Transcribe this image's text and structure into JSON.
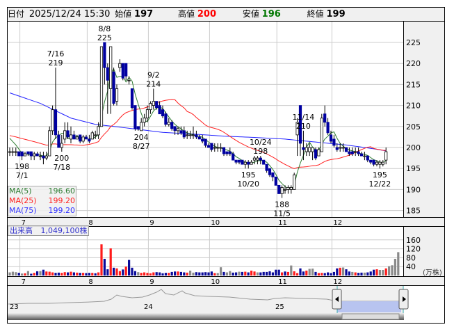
{
  "header": {
    "date_label": "日付",
    "datetime": "2025/12/24 15:30",
    "open_label": "始値",
    "open": "197",
    "high_label": "高値",
    "high": "200",
    "low_label": "安値",
    "low": "196",
    "close_label": "終値",
    "close": "199"
  },
  "legend": {
    "ma5_label": "MA(5)",
    "ma5": "196.60",
    "ma25_label": "MA(25)",
    "ma25": "199.20",
    "ma75_label": "MA(75)",
    "ma75": "199.20"
  },
  "volume": {
    "label": "出来高",
    "value": "1,049,100株",
    "unit": "(万株)"
  },
  "colors": {
    "up_candle": "#ffffff",
    "down_candle": "#0000a0",
    "ma5": "#2e7d32",
    "ma25": "#ff2020",
    "ma75": "#2020ff",
    "vol_up": "#ff1a1a",
    "vol_down": "#0a0a9a",
    "vol_flat": "#8a8a8a",
    "high": "#ff0000",
    "low": "#007000"
  },
  "chart_data": {
    "type": "candlestick",
    "y_ticks": [
      185,
      190,
      195,
      200,
      205,
      210,
      215,
      220,
      225
    ],
    "ylim": [
      182,
      229
    ],
    "volume_ticks": [
      40,
      80,
      120,
      160
    ],
    "months": [
      {
        "label": "7",
        "index": 4
      },
      {
        "label": "8",
        "index": 26
      },
      {
        "label": "9",
        "index": 46
      },
      {
        "label": "10",
        "index": 66
      },
      {
        "label": "11",
        "index": 88
      },
      {
        "label": "12",
        "index": 106
      }
    ],
    "navigator_years": [
      "23",
      "24",
      "25"
    ],
    "pre_close": 203,
    "annotations": [
      {
        "date": "7/1",
        "value": "198",
        "index": 4,
        "pos": "below"
      },
      {
        "date": "7/16",
        "value": "219",
        "index": 15,
        "pos": "above"
      },
      {
        "date": "7/18",
        "value": "200",
        "index": 17,
        "pos": "below"
      },
      {
        "date": "8/8",
        "value": "225",
        "index": 31,
        "pos": "above"
      },
      {
        "date": "8/27",
        "value": "204",
        "index": 43,
        "pos": "below"
      },
      {
        "date": "9/2",
        "value": "214",
        "index": 47,
        "pos": "above"
      },
      {
        "date": "10/20",
        "value": "195",
        "index": 78,
        "pos": "below"
      },
      {
        "date": "10/24",
        "value": "198",
        "index": 82,
        "pos": "above"
      },
      {
        "date": "11/5",
        "value": "188",
        "index": 89,
        "pos": "below"
      },
      {
        "date": "11/14",
        "value": "210",
        "index": 96,
        "pos": "above"
      },
      {
        "date": "12/22",
        "value": "195",
        "index": 121,
        "pos": "below"
      }
    ],
    "ohlc": [
      [
        199,
        200,
        198,
        199
      ],
      [
        199,
        200,
        198,
        199
      ],
      [
        199,
        200,
        198,
        199
      ],
      [
        199,
        199,
        198,
        198
      ],
      [
        199,
        199,
        197,
        198
      ],
      [
        198,
        199,
        198,
        198.5
      ],
      [
        199,
        199,
        198,
        198.5
      ],
      [
        199,
        199,
        197,
        198
      ],
      [
        198,
        199,
        197,
        198.5
      ],
      [
        198.5,
        199,
        198,
        198
      ],
      [
        198,
        199,
        197,
        198
      ],
      [
        198,
        199,
        196,
        197.5
      ],
      [
        197.5,
        199,
        197,
        198
      ],
      [
        198,
        205,
        198,
        204
      ],
      [
        204,
        210,
        203,
        209
      ],
      [
        209,
        219,
        202,
        203
      ],
      [
        203,
        204,
        200,
        200
      ],
      [
        200,
        203,
        199,
        201
      ],
      [
        202,
        206,
        201,
        204
      ],
      [
        204,
        206,
        202,
        202.5
      ],
      [
        202,
        205,
        201,
        203
      ],
      [
        203,
        204,
        202,
        202
      ],
      [
        202,
        203,
        202,
        202.5
      ],
      [
        203,
        203,
        201,
        201.5
      ],
      [
        201.5,
        203,
        201,
        202.5
      ],
      [
        202.5,
        203,
        202,
        202
      ],
      [
        202,
        203,
        201,
        201.5
      ],
      [
        202,
        204,
        202,
        203.5
      ],
      [
        203,
        204,
        202,
        203
      ],
      [
        203,
        206,
        202,
        205
      ],
      [
        205,
        224,
        205,
        224
      ],
      [
        225,
        225,
        215,
        219
      ],
      [
        219,
        220,
        208,
        216
      ],
      [
        214,
        224,
        208,
        224
      ],
      [
        218,
        219,
        210,
        210.5
      ],
      [
        211,
        215,
        210,
        214
      ],
      [
        219,
        221,
        218,
        220
      ],
      [
        220,
        220,
        216,
        216.5
      ],
      [
        220,
        220,
        216,
        217
      ],
      [
        216,
        217,
        215,
        216
      ],
      [
        214,
        214,
        209,
        209.5
      ],
      [
        210,
        210,
        204,
        204.5
      ],
      [
        205,
        205,
        204,
        204.5
      ],
      [
        204,
        207,
        204,
        206
      ],
      [
        206,
        208,
        205,
        207
      ],
      [
        207,
        210,
        206,
        209
      ],
      [
        209,
        211,
        208,
        210.5
      ],
      [
        210,
        214,
        209,
        211
      ],
      [
        211,
        211,
        209,
        209.5
      ],
      [
        210,
        211,
        208,
        208
      ],
      [
        209,
        210,
        207,
        207.5
      ],
      [
        208,
        208.5,
        205,
        205.5
      ],
      [
        205.5,
        207,
        205,
        206
      ],
      [
        206,
        206.5,
        204,
        204.5
      ],
      [
        205,
        205,
        203,
        204
      ],
      [
        204,
        205,
        203,
        204.5
      ],
      [
        204,
        205,
        203,
        203.5
      ],
      [
        204,
        205,
        202,
        202.5
      ],
      [
        203,
        204,
        202,
        203
      ],
      [
        203,
        204,
        202,
        203
      ],
      [
        203,
        205,
        202,
        203
      ],
      [
        203,
        204,
        202,
        202.5
      ],
      [
        202.5,
        203,
        202,
        202
      ],
      [
        202,
        203,
        201,
        201.5
      ],
      [
        202,
        202,
        200,
        200.5
      ],
      [
        200.5,
        201,
        200,
        200
      ],
      [
        201,
        201,
        199,
        199.5
      ],
      [
        200,
        201,
        199,
        200
      ],
      [
        200,
        201,
        199,
        200
      ],
      [
        200,
        201,
        199,
        200
      ],
      [
        200,
        200,
        198,
        198.5
      ],
      [
        199,
        199,
        198,
        198.5
      ],
      [
        199,
        200,
        198,
        198.5
      ],
      [
        198.5,
        199,
        197,
        197
      ],
      [
        197,
        197,
        196,
        196.5
      ],
      [
        197,
        197,
        196,
        196.5
      ],
      [
        197,
        197,
        196,
        196
      ],
      [
        196,
        197,
        195,
        196.5
      ],
      [
        196.5,
        197,
        195,
        196
      ],
      [
        196,
        197,
        196,
        196.5
      ],
      [
        197,
        198,
        196,
        197.5
      ],
      [
        197,
        198,
        196,
        197.5
      ],
      [
        197.5,
        198,
        196,
        197
      ],
      [
        197,
        197,
        196,
        196
      ],
      [
        196,
        196,
        194,
        194.5
      ],
      [
        195,
        195,
        193,
        193.5
      ],
      [
        194,
        194,
        192,
        193
      ],
      [
        193,
        193,
        191,
        191
      ],
      [
        191,
        191,
        189,
        189
      ],
      [
        189,
        191,
        188,
        190.5
      ],
      [
        190,
        191,
        189,
        190
      ],
      [
        190,
        191,
        189,
        190.5
      ],
      [
        190,
        191,
        189,
        190.5
      ],
      [
        190,
        194,
        190,
        193.5
      ],
      [
        203,
        207,
        198,
        206
      ],
      [
        210,
        210,
        198,
        201
      ],
      [
        200,
        204,
        197,
        199.5
      ],
      [
        199,
        201,
        198,
        200
      ],
      [
        199,
        201,
        198,
        200
      ],
      [
        199,
        200,
        197,
        200
      ],
      [
        199.5,
        200,
        197,
        197.5
      ],
      [
        198,
        200,
        198,
        199.5
      ],
      [
        199,
        208,
        199,
        207
      ],
      [
        208,
        210,
        205,
        206
      ],
      [
        206,
        207,
        203,
        203.5
      ],
      [
        203,
        204,
        201,
        201.5
      ],
      [
        202,
        203,
        200,
        200.5
      ],
      [
        200,
        201,
        199,
        199.5
      ],
      [
        200,
        201,
        199,
        200
      ],
      [
        200,
        201,
        199,
        200
      ],
      [
        200,
        200,
        199,
        199
      ],
      [
        199,
        200,
        198,
        198.5
      ],
      [
        199,
        200,
        198,
        198.5
      ],
      [
        199,
        200,
        198,
        199
      ],
      [
        199,
        200,
        198,
        198.5
      ],
      [
        198.5,
        199,
        198,
        198
      ],
      [
        198,
        199,
        197,
        198
      ],
      [
        198,
        198,
        196.5,
        197
      ],
      [
        197,
        197,
        196,
        196.5
      ],
      [
        197,
        197,
        195.5,
        196
      ],
      [
        196,
        197,
        195.5,
        196.5
      ],
      [
        196,
        197,
        195,
        196.5
      ],
      [
        196,
        197,
        195.5,
        196.5
      ],
      [
        197,
        200,
        196,
        199
      ]
    ],
    "volumes": [
      14,
      17,
      15,
      12,
      9,
      10,
      20,
      8,
      12,
      19,
      20,
      26,
      18,
      17,
      14,
      12,
      13,
      12,
      15,
      14,
      17,
      14,
      13,
      12,
      12,
      11,
      12,
      12,
      10,
      14,
      140,
      75,
      28,
      122,
      35,
      32,
      20,
      27,
      40,
      70,
      35,
      20,
      15,
      12,
      14,
      12,
      10,
      14,
      15,
      14,
      10,
      12,
      12,
      16,
      18,
      18,
      16,
      14,
      13,
      22,
      13,
      15,
      14,
      14,
      15,
      14,
      18,
      11,
      11,
      37,
      16,
      14,
      20,
      13,
      14,
      17,
      16,
      17,
      14,
      22,
      18,
      14,
      14,
      16,
      16,
      19,
      14,
      26,
      26,
      14,
      18,
      16,
      45,
      19,
      11,
      32,
      18,
      22,
      30,
      31,
      16,
      11,
      12,
      11,
      14,
      11,
      16,
      32,
      35,
      36,
      28,
      18,
      16,
      14,
      12,
      13,
      13,
      14,
      18,
      26,
      28,
      25,
      25,
      32,
      42,
      46,
      75,
      105
    ],
    "ma75_anchors": [
      [
        0,
        213
      ],
      [
        10,
        210.5
      ],
      [
        20,
        207
      ],
      [
        28,
        205.5
      ],
      [
        40,
        204.5
      ],
      [
        50,
        203.6
      ],
      [
        60,
        203.2
      ],
      [
        70,
        202.7
      ],
      [
        80,
        202.4
      ],
      [
        90,
        202
      ],
      [
        100,
        201.3
      ],
      [
        110,
        200.6
      ],
      [
        118,
        199.8
      ],
      [
        123,
        199.2
      ]
    ]
  }
}
